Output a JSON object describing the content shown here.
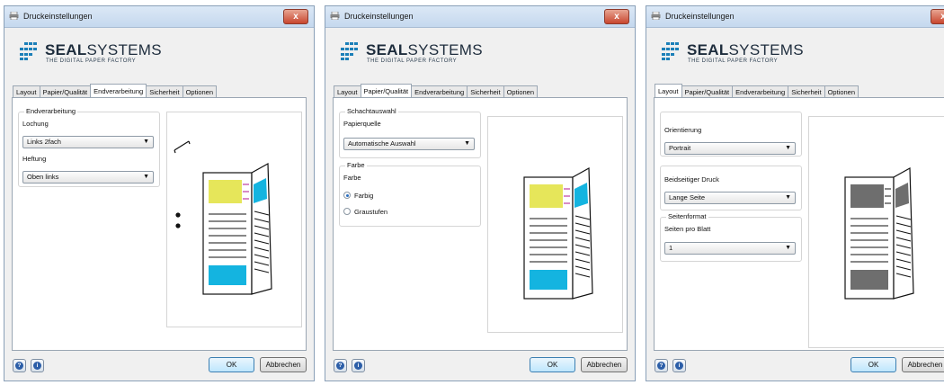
{
  "dialog_title": "Druckeinstellungen",
  "close_symbol": "x",
  "brand": {
    "name_bold": "SEAL",
    "name_regular": "SYSTEMS",
    "tagline": "THE DIGITAL PAPER FACTORY"
  },
  "tabs": [
    "Layout",
    "Papier/Qualität",
    "Endverarbeitung",
    "Sicherheit",
    "Optionen"
  ],
  "footer": {
    "help_symbol": "?",
    "info_symbol": "i",
    "ok_label": "OK",
    "cancel_label": "Abbrechen"
  },
  "dialogs": [
    {
      "active_tab": "Endverarbeitung",
      "group_endverarbeitung": {
        "title": "Endverarbeitung",
        "lochung_label": "Lochung",
        "lochung_value": "Links 2fach",
        "heftung_label": "Heftung",
        "heftung_value": "Oben links"
      }
    },
    {
      "active_tab": "Papier/Qualität",
      "group_schachtauswahl": {
        "title": "Schachtauswahl",
        "papierquelle_label": "Papierquelle",
        "papierquelle_value": "Automatische Auswahl"
      },
      "group_farbe": {
        "title": "Farbe",
        "farbe_label": "Farbe",
        "option_farbig": "Farbig",
        "option_graustufen": "Graustufen",
        "selected": "Farbig"
      }
    },
    {
      "active_tab": "Layout",
      "orientierung_label": "Orientierung",
      "orientierung_value": "Portrait",
      "beidseitig_label": "Beidseitiger Druck",
      "beidseitig_value": "Lange Seite",
      "group_seitenformat": {
        "title": "Seitenformat",
        "seiten_label": "Seiten pro Blatt",
        "seiten_value": "1"
      }
    }
  ],
  "colors": {
    "accent_yellow": "#e6e65a",
    "accent_cyan": "#14b4e0",
    "accent_gray": "#6e6e6e",
    "accent_magenta": "#b0188c"
  }
}
